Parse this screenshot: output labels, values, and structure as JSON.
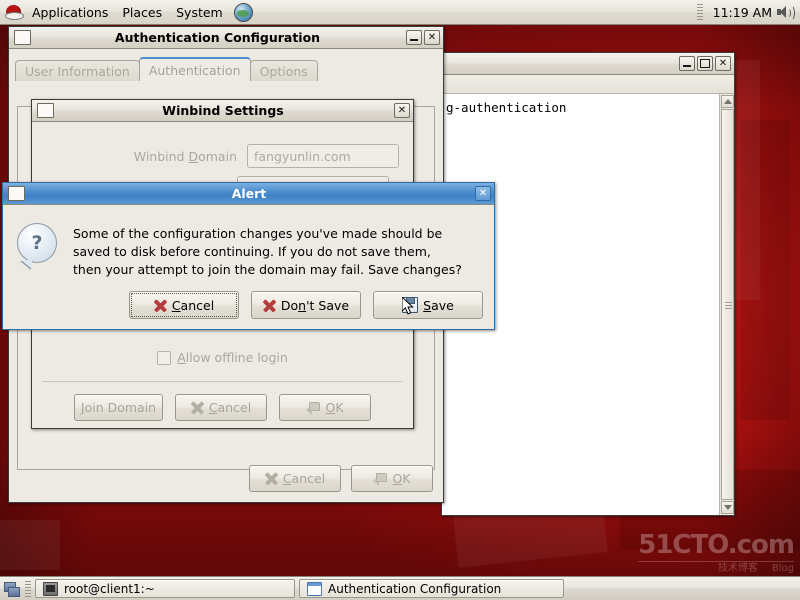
{
  "panel": {
    "applications_label": "Applications",
    "places_label": "Places",
    "system_label": "System",
    "clock": "11:19 AM",
    "logo_icon": "redhat-logo-icon",
    "browser_icon": "web-browser-icon",
    "volume_icon": "speaker-volume-icon"
  },
  "taskbar": {
    "show_desktop_icon": "show-desktop-icon",
    "items": [
      {
        "label": "root@client1:~",
        "icon": "terminal-icon"
      },
      {
        "label": "Authentication Configuration",
        "icon": "window-icon"
      }
    ]
  },
  "terminal_window": {
    "title": "",
    "content_line": "g-authentication",
    "minimize_label": "–",
    "maximize_label": "□",
    "close_label": "✕"
  },
  "auth_window": {
    "title": "Authentication Configuration",
    "minimize_label": "–",
    "close_label": "✕",
    "tabs": [
      {
        "label": "User Information",
        "active": false
      },
      {
        "label": "Authentication",
        "active": true
      },
      {
        "label": "Options",
        "active": false
      }
    ],
    "cancel_label": "Cancel",
    "cancel_mnemonic": "C",
    "ok_label": "OK",
    "ok_mnemonic": "O"
  },
  "winbind_dialog": {
    "title": "Winbind Settings",
    "close_label": "✕",
    "domain_label_pre": "Winbind ",
    "domain_label_mn": "D",
    "domain_label_post": "omain",
    "domain_value": "fangyunlin.com",
    "offline_login_label_pre": "A",
    "offline_login_label_post": "llow offline login",
    "join_domain_label": "Join Domain",
    "join_domain_mnemonic": "J",
    "cancel_label": "Cancel",
    "cancel_mnemonic": "C",
    "ok_label": "OK",
    "ok_mnemonic": "O"
  },
  "alert_dialog": {
    "title": "Alert",
    "close_label": "✕",
    "icon": "question-mark-icon",
    "icon_glyph": "?",
    "message_line1": "Some of the configuration changes you've made should be",
    "message_line2": "saved to disk before continuing.  If you do not save them,",
    "message_line3": "then your attempt to join the domain may fail.  Save changes?",
    "cancel_label_pre": "",
    "cancel_mnemonic": "C",
    "cancel_label_post": "ancel",
    "dontsave_label_pre": "Do",
    "dontsave_mnemonic": "n",
    "dontsave_label_post": "'t Save",
    "save_label_pre": "",
    "save_mnemonic": "S",
    "save_label_post": "ave"
  },
  "watermark": {
    "main": "51CTO.com",
    "sub_left": "技术博客",
    "sub_right": "Blog"
  },
  "colors": {
    "desktop_red": "#9f0f10",
    "titlebar_active_blue": "#4e8fcd",
    "tab_accent_blue": "#4f8fd0",
    "cancel_x_red": "#b53c3c"
  }
}
